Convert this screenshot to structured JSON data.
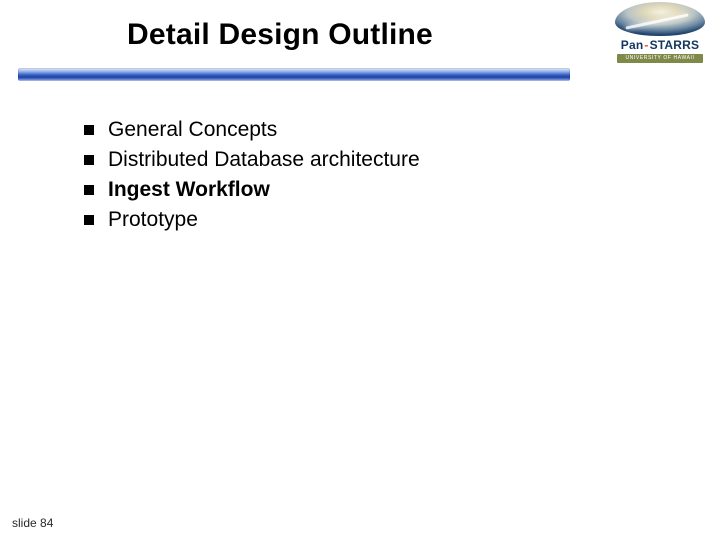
{
  "title": "Detail Design Outline",
  "logo": {
    "brand_left": "Pan",
    "brand_dash": "-",
    "brand_right": "STARRS",
    "subbar": "UNIVERSITY OF HAWAII"
  },
  "bullets": {
    "items": [
      {
        "text": "General Concepts",
        "bold": false
      },
      {
        "text": "Distributed Database architecture",
        "bold": false
      },
      {
        "text": "Ingest Workflow",
        "bold": true
      },
      {
        "text": "Prototype",
        "bold": false
      }
    ]
  },
  "footer": "slide 84"
}
